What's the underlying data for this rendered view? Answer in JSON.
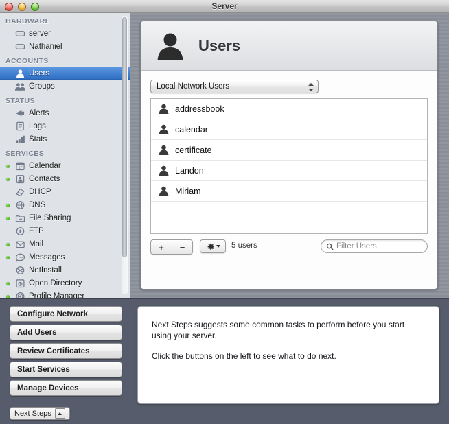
{
  "window": {
    "title": "Server",
    "controls": {
      "close": "close-button",
      "minimize": "minimize-button",
      "zoom": "zoom-button"
    }
  },
  "sidebar": {
    "sections": [
      {
        "title": "HARDWARE",
        "items": [
          {
            "label": "server",
            "icon": "server-icon",
            "selected": false,
            "status": null
          },
          {
            "label": "Nathaniel",
            "icon": "server-icon",
            "selected": false,
            "status": null
          }
        ]
      },
      {
        "title": "ACCOUNTS",
        "items": [
          {
            "label": "Users",
            "icon": "user-icon",
            "selected": true,
            "status": null
          },
          {
            "label": "Groups",
            "icon": "group-icon",
            "selected": false,
            "status": null
          }
        ]
      },
      {
        "title": "STATUS",
        "items": [
          {
            "label": "Alerts",
            "icon": "megaphone-icon",
            "selected": false,
            "status": null
          },
          {
            "label": "Logs",
            "icon": "document-icon",
            "selected": false,
            "status": null
          },
          {
            "label": "Stats",
            "icon": "bar-chart-icon",
            "selected": false,
            "status": null
          }
        ]
      },
      {
        "title": "SERVICES",
        "items": [
          {
            "label": "Calendar",
            "icon": "calendar-icon",
            "selected": false,
            "status": "on"
          },
          {
            "label": "Contacts",
            "icon": "contacts-icon",
            "selected": false,
            "status": "on"
          },
          {
            "label": "DHCP",
            "icon": "dhcp-icon",
            "selected": false,
            "status": "off"
          },
          {
            "label": "DNS",
            "icon": "dns-icon",
            "selected": false,
            "status": "on"
          },
          {
            "label": "File Sharing",
            "icon": "folder-icon",
            "selected": false,
            "status": "on"
          },
          {
            "label": "FTP",
            "icon": "ftp-icon",
            "selected": false,
            "status": "off"
          },
          {
            "label": "Mail",
            "icon": "mail-icon",
            "selected": false,
            "status": "on"
          },
          {
            "label": "Messages",
            "icon": "messages-icon",
            "selected": false,
            "status": "on"
          },
          {
            "label": "NetInstall",
            "icon": "netinstall-icon",
            "selected": false,
            "status": "off"
          },
          {
            "label": "Open Directory",
            "icon": "open-directory-icon",
            "selected": false,
            "status": "on"
          },
          {
            "label": "Profile Manager",
            "icon": "profile-manager-icon",
            "selected": false,
            "status": "on"
          }
        ]
      }
    ]
  },
  "main": {
    "header": {
      "title": "Users",
      "icon": "user-silhouette-icon"
    },
    "scope_popup": {
      "value": "Local Network Users"
    },
    "users": [
      {
        "name": "addressbook"
      },
      {
        "name": "calendar"
      },
      {
        "name": "certificate"
      },
      {
        "name": "Landon"
      },
      {
        "name": "Miriam"
      }
    ],
    "toolbar": {
      "add_label": "+",
      "remove_label": "−",
      "gear_label": "gear-icon",
      "count_label": "5 users",
      "filter_placeholder": "Filter Users"
    }
  },
  "next_steps": {
    "buttons": [
      {
        "label": "Configure Network"
      },
      {
        "label": "Add Users"
      },
      {
        "label": "Review Certificates"
      },
      {
        "label": "Start Services"
      },
      {
        "label": "Manage Devices"
      }
    ],
    "info": {
      "paragraph1": "Next Steps suggests some common tasks to perform before you start using your server.",
      "paragraph2": "Click the buttons on the left to see what to do next."
    },
    "toggle_label": "Next Steps"
  },
  "colors": {
    "selection_blue": "#2f6fc4",
    "status_green": "#3aa60e",
    "bottom_bar": "#565c6b",
    "sidebar_bg": "#dfe2e7"
  }
}
